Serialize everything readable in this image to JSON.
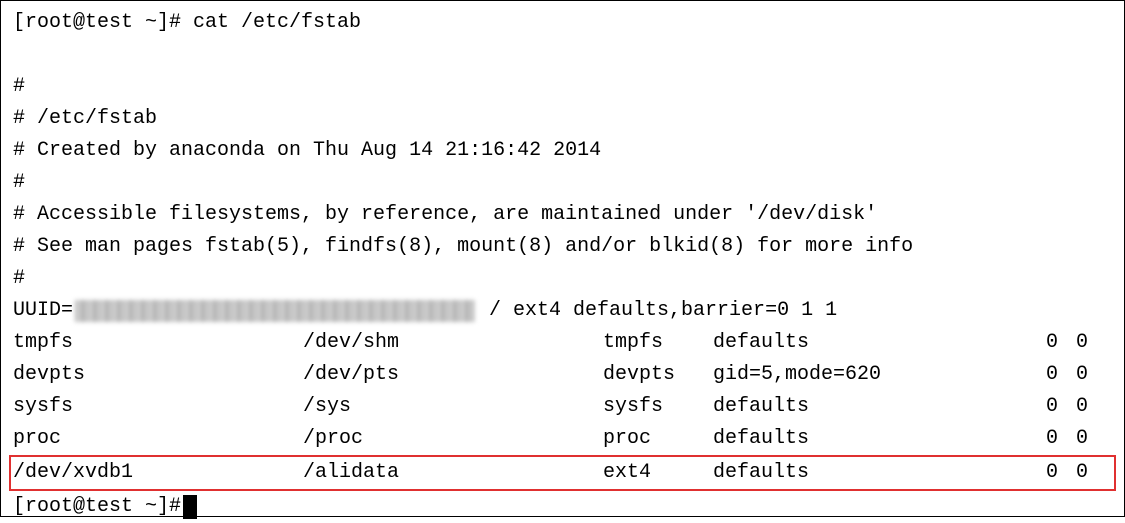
{
  "prompt1": "[root@test ~]# ",
  "command": "cat /etc/fstab",
  "comment1": "#",
  "comment2": "# /etc/fstab",
  "comment3": "# Created by anaconda on Thu Aug 14 21:16:42 2014",
  "comment4": "#",
  "comment5": "# Accessible filesystems, by reference, are maintained under '/dev/disk'",
  "comment6": "# See man pages fstab(5), findfs(8), mount(8) and/or blkid(8) for more info",
  "comment7": "#",
  "uuid_prefix": "UUID=",
  "uuid_suffix": " / ext4 defaults,barrier=0 1 1",
  "rows": [
    {
      "device": "tmpfs",
      "mount": "/dev/shm",
      "type": "tmpfs",
      "opts": "defaults",
      "dump": "0",
      "pass": "0"
    },
    {
      "device": "devpts",
      "mount": "/dev/pts",
      "type": "devpts",
      "opts": "gid=5,mode=620",
      "dump": "0",
      "pass": "0"
    },
    {
      "device": "sysfs",
      "mount": "/sys",
      "type": "sysfs",
      "opts": "defaults",
      "dump": "0",
      "pass": "0"
    },
    {
      "device": "proc",
      "mount": "/proc",
      "type": "proc",
      "opts": "defaults",
      "dump": "0",
      "pass": "0"
    },
    {
      "device": "/dev/xvdb1",
      "mount": "/alidata",
      "type": "ext4",
      "opts": "defaults",
      "dump": "0",
      "pass": "0"
    }
  ],
  "prompt2": "[root@test ~]# "
}
